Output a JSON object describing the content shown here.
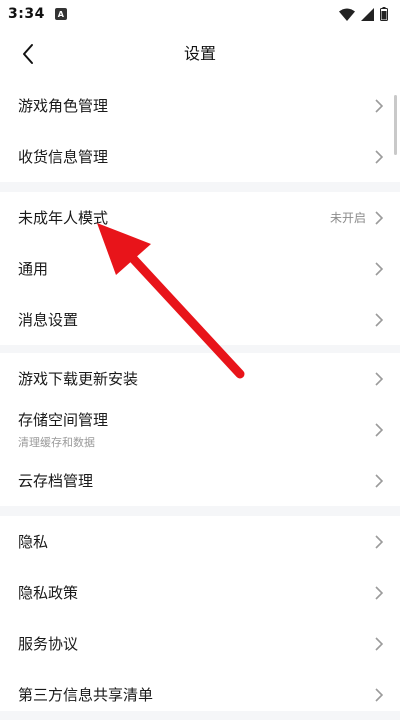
{
  "status": {
    "time": "3:34",
    "notification_icon": "A"
  },
  "header": {
    "title": "设置"
  },
  "sections": [
    {
      "rows": [
        {
          "label": "游戏角色管理"
        },
        {
          "label": "收货信息管理"
        }
      ]
    },
    {
      "rows": [
        {
          "label": "未成年人模式",
          "value": "未开启"
        },
        {
          "label": "通用"
        },
        {
          "label": "消息设置"
        }
      ]
    },
    {
      "rows": [
        {
          "label": "游戏下载更新安装"
        },
        {
          "label": "存储空间管理",
          "sub": "清理缓存和数据"
        },
        {
          "label": "云存档管理"
        }
      ]
    },
    {
      "rows": [
        {
          "label": "隐私"
        },
        {
          "label": "隐私政策"
        },
        {
          "label": "服务协议"
        },
        {
          "label": "第三方信息共享清单"
        }
      ]
    }
  ],
  "colors": {
    "annotation_arrow": "#e8141a",
    "background": "#f5f6f8"
  }
}
